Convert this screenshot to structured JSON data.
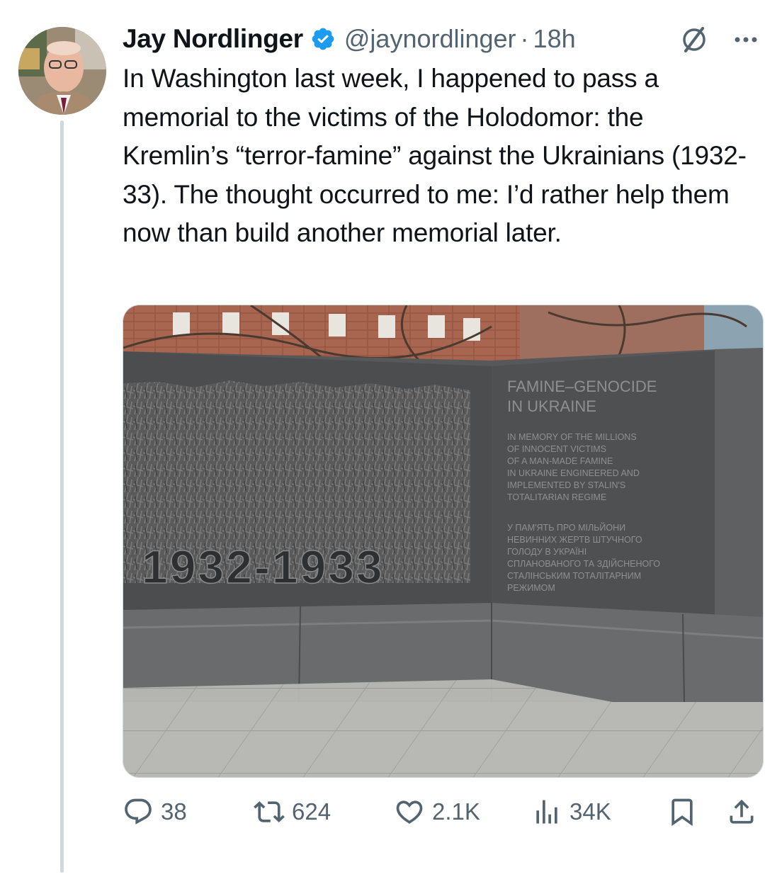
{
  "tweet": {
    "author_name": "Jay Nordlinger",
    "handle": "@jaynordlinger",
    "separator": "·",
    "time": "18h",
    "verified": true,
    "text": "In Washington last week, I happened to pass a memorial to the victims of the Holodomor: the Kremlin’s “terror-famine” against the Ukrainians (1932-33). The thought occurred to me: I’d rather help them now than build another memorial later."
  },
  "media": {
    "plaque_title": [
      "FAMINE–GENOCIDE",
      "IN UKRAINE"
    ],
    "plaque_english": [
      "IN MEMORY OF THE MILLIONS",
      "OF INNOCENT VICTIMS",
      "OF A MAN-MADE FAMINE",
      "IN UKRAINE ENGINEERED AND",
      "IMPLEMENTED BY STALIN'S",
      "TOTALITARIAN REGIME"
    ],
    "plaque_ukrainian": [
      "У ПАМ'ЯТЬ ПРО МІЛЬЙОНИ",
      "НЕВИННИХ ЖЕРТВ ШТУЧНОГО",
      "ГОЛОДУ В УКРАЇНІ",
      "СПЛАНОВАНОГО ТА ЗДІЙСНЕНОГО",
      "СТАЛІНСЬКИМ ТОТАЛІТАРНИМ",
      "РЕЖИМОМ"
    ],
    "years": "1932-1933"
  },
  "actions": {
    "replies": "38",
    "reposts": "624",
    "likes": "2.1K",
    "views": "34K"
  },
  "colors": {
    "text": "#0f1419",
    "secondary": "#536471",
    "verified": "#1d9bf0",
    "thread_line": "#cfd9de"
  },
  "icons": [
    "verified-badge-icon",
    "grok-icon",
    "more-icon",
    "reply-icon",
    "repost-icon",
    "like-icon",
    "views-icon",
    "bookmark-icon",
    "share-icon"
  ]
}
